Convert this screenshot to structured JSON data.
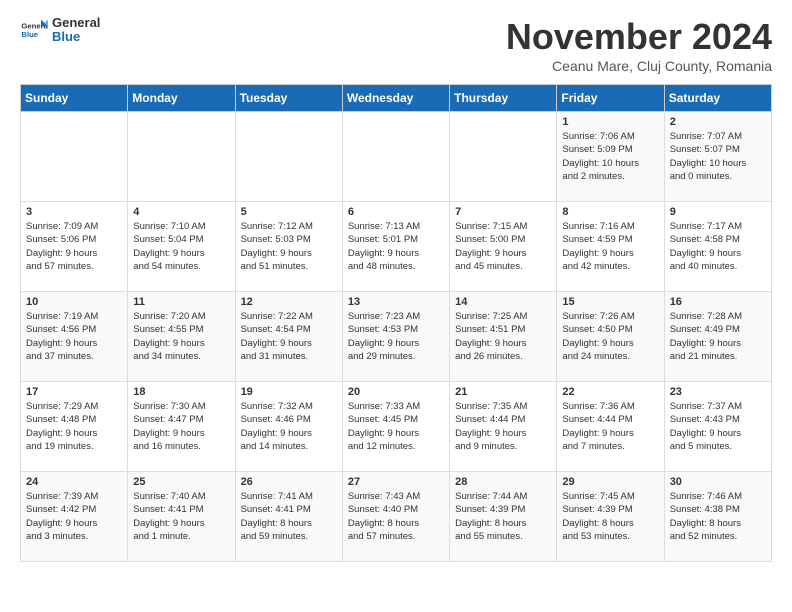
{
  "logo": {
    "general": "General",
    "blue": "Blue"
  },
  "title": "November 2024",
  "location": "Ceanu Mare, Cluj County, Romania",
  "weekdays": [
    "Sunday",
    "Monday",
    "Tuesday",
    "Wednesday",
    "Thursday",
    "Friday",
    "Saturday"
  ],
  "weeks": [
    [
      {
        "day": "",
        "info": ""
      },
      {
        "day": "",
        "info": ""
      },
      {
        "day": "",
        "info": ""
      },
      {
        "day": "",
        "info": ""
      },
      {
        "day": "",
        "info": ""
      },
      {
        "day": "1",
        "info": "Sunrise: 7:06 AM\nSunset: 5:09 PM\nDaylight: 10 hours\nand 2 minutes."
      },
      {
        "day": "2",
        "info": "Sunrise: 7:07 AM\nSunset: 5:07 PM\nDaylight: 10 hours\nand 0 minutes."
      }
    ],
    [
      {
        "day": "3",
        "info": "Sunrise: 7:09 AM\nSunset: 5:06 PM\nDaylight: 9 hours\nand 57 minutes."
      },
      {
        "day": "4",
        "info": "Sunrise: 7:10 AM\nSunset: 5:04 PM\nDaylight: 9 hours\nand 54 minutes."
      },
      {
        "day": "5",
        "info": "Sunrise: 7:12 AM\nSunset: 5:03 PM\nDaylight: 9 hours\nand 51 minutes."
      },
      {
        "day": "6",
        "info": "Sunrise: 7:13 AM\nSunset: 5:01 PM\nDaylight: 9 hours\nand 48 minutes."
      },
      {
        "day": "7",
        "info": "Sunrise: 7:15 AM\nSunset: 5:00 PM\nDaylight: 9 hours\nand 45 minutes."
      },
      {
        "day": "8",
        "info": "Sunrise: 7:16 AM\nSunset: 4:59 PM\nDaylight: 9 hours\nand 42 minutes."
      },
      {
        "day": "9",
        "info": "Sunrise: 7:17 AM\nSunset: 4:58 PM\nDaylight: 9 hours\nand 40 minutes."
      }
    ],
    [
      {
        "day": "10",
        "info": "Sunrise: 7:19 AM\nSunset: 4:56 PM\nDaylight: 9 hours\nand 37 minutes."
      },
      {
        "day": "11",
        "info": "Sunrise: 7:20 AM\nSunset: 4:55 PM\nDaylight: 9 hours\nand 34 minutes."
      },
      {
        "day": "12",
        "info": "Sunrise: 7:22 AM\nSunset: 4:54 PM\nDaylight: 9 hours\nand 31 minutes."
      },
      {
        "day": "13",
        "info": "Sunrise: 7:23 AM\nSunset: 4:53 PM\nDaylight: 9 hours\nand 29 minutes."
      },
      {
        "day": "14",
        "info": "Sunrise: 7:25 AM\nSunset: 4:51 PM\nDaylight: 9 hours\nand 26 minutes."
      },
      {
        "day": "15",
        "info": "Sunrise: 7:26 AM\nSunset: 4:50 PM\nDaylight: 9 hours\nand 24 minutes."
      },
      {
        "day": "16",
        "info": "Sunrise: 7:28 AM\nSunset: 4:49 PM\nDaylight: 9 hours\nand 21 minutes."
      }
    ],
    [
      {
        "day": "17",
        "info": "Sunrise: 7:29 AM\nSunset: 4:48 PM\nDaylight: 9 hours\nand 19 minutes."
      },
      {
        "day": "18",
        "info": "Sunrise: 7:30 AM\nSunset: 4:47 PM\nDaylight: 9 hours\nand 16 minutes."
      },
      {
        "day": "19",
        "info": "Sunrise: 7:32 AM\nSunset: 4:46 PM\nDaylight: 9 hours\nand 14 minutes."
      },
      {
        "day": "20",
        "info": "Sunrise: 7:33 AM\nSunset: 4:45 PM\nDaylight: 9 hours\nand 12 minutes."
      },
      {
        "day": "21",
        "info": "Sunrise: 7:35 AM\nSunset: 4:44 PM\nDaylight: 9 hours\nand 9 minutes."
      },
      {
        "day": "22",
        "info": "Sunrise: 7:36 AM\nSunset: 4:44 PM\nDaylight: 9 hours\nand 7 minutes."
      },
      {
        "day": "23",
        "info": "Sunrise: 7:37 AM\nSunset: 4:43 PM\nDaylight: 9 hours\nand 5 minutes."
      }
    ],
    [
      {
        "day": "24",
        "info": "Sunrise: 7:39 AM\nSunset: 4:42 PM\nDaylight: 9 hours\nand 3 minutes."
      },
      {
        "day": "25",
        "info": "Sunrise: 7:40 AM\nSunset: 4:41 PM\nDaylight: 9 hours\nand 1 minute."
      },
      {
        "day": "26",
        "info": "Sunrise: 7:41 AM\nSunset: 4:41 PM\nDaylight: 8 hours\nand 59 minutes."
      },
      {
        "day": "27",
        "info": "Sunrise: 7:43 AM\nSunset: 4:40 PM\nDaylight: 8 hours\nand 57 minutes."
      },
      {
        "day": "28",
        "info": "Sunrise: 7:44 AM\nSunset: 4:39 PM\nDaylight: 8 hours\nand 55 minutes."
      },
      {
        "day": "29",
        "info": "Sunrise: 7:45 AM\nSunset: 4:39 PM\nDaylight: 8 hours\nand 53 minutes."
      },
      {
        "day": "30",
        "info": "Sunrise: 7:46 AM\nSunset: 4:38 PM\nDaylight: 8 hours\nand 52 minutes."
      }
    ]
  ]
}
